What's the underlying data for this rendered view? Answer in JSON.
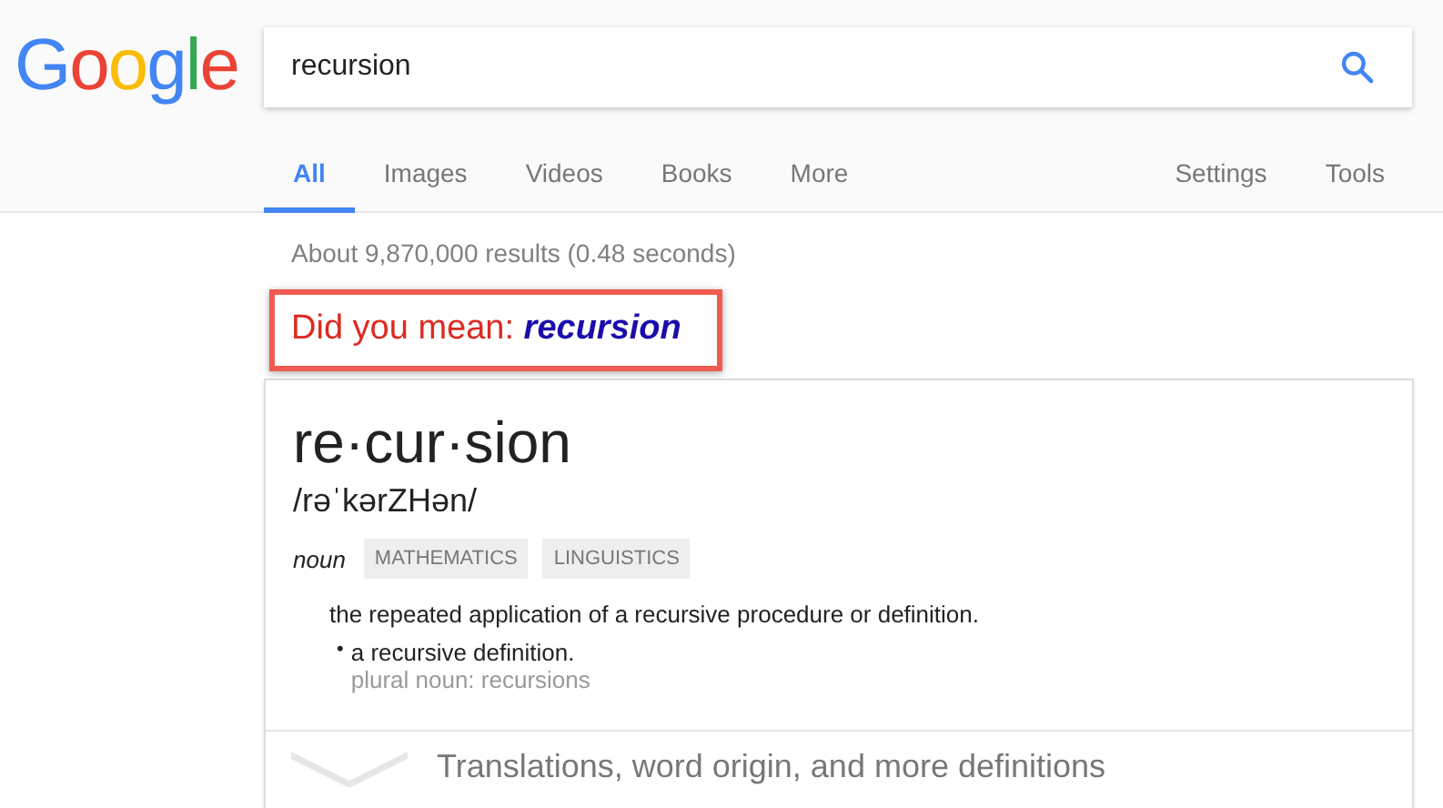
{
  "logo": {
    "text": "Google"
  },
  "search": {
    "value": "recursion"
  },
  "tabs": [
    {
      "label": "All",
      "selected": true
    },
    {
      "label": "Images",
      "selected": false
    },
    {
      "label": "Videos",
      "selected": false
    },
    {
      "label": "Books",
      "selected": false
    },
    {
      "label": "More",
      "selected": false
    }
  ],
  "tools": [
    {
      "label": "Settings"
    },
    {
      "label": "Tools"
    }
  ],
  "result_stats": "About 9,870,000 results (0.48 seconds)",
  "did_you_mean": {
    "prompt": "Did you mean:",
    "suggestion": "recursion"
  },
  "definition": {
    "headword": "re·cur·sion",
    "pronunciation": "/rəˈkərZHən/",
    "part_of_speech": "noun",
    "tags": [
      "MATHEMATICS",
      "LINGUISTICS"
    ],
    "sense": "the repeated application of a recursive procedure or definition.",
    "subsenses": [
      {
        "bullet": "•",
        "text": "a recursive definition.",
        "note": "plural noun: recursions"
      }
    ],
    "more_link": "Translations, word origin, and more definitions"
  }
}
